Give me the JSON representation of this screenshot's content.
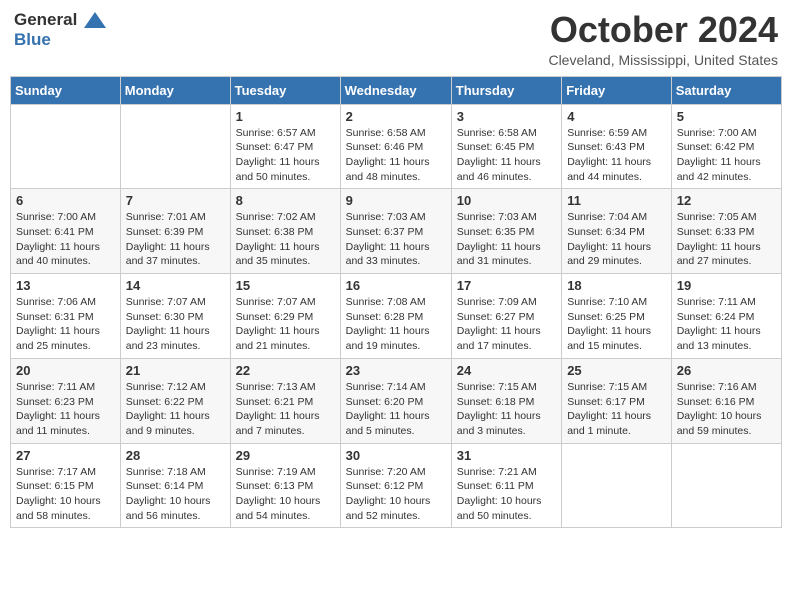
{
  "header": {
    "logo_general": "General",
    "logo_blue": "Blue",
    "month": "October 2024",
    "location": "Cleveland, Mississippi, United States"
  },
  "days_of_week": [
    "Sunday",
    "Monday",
    "Tuesday",
    "Wednesday",
    "Thursday",
    "Friday",
    "Saturday"
  ],
  "weeks": [
    [
      {
        "day": "",
        "info": ""
      },
      {
        "day": "",
        "info": ""
      },
      {
        "day": "1",
        "info": "Sunrise: 6:57 AM\nSunset: 6:47 PM\nDaylight: 11 hours and 50 minutes."
      },
      {
        "day": "2",
        "info": "Sunrise: 6:58 AM\nSunset: 6:46 PM\nDaylight: 11 hours and 48 minutes."
      },
      {
        "day": "3",
        "info": "Sunrise: 6:58 AM\nSunset: 6:45 PM\nDaylight: 11 hours and 46 minutes."
      },
      {
        "day": "4",
        "info": "Sunrise: 6:59 AM\nSunset: 6:43 PM\nDaylight: 11 hours and 44 minutes."
      },
      {
        "day": "5",
        "info": "Sunrise: 7:00 AM\nSunset: 6:42 PM\nDaylight: 11 hours and 42 minutes."
      }
    ],
    [
      {
        "day": "6",
        "info": "Sunrise: 7:00 AM\nSunset: 6:41 PM\nDaylight: 11 hours and 40 minutes."
      },
      {
        "day": "7",
        "info": "Sunrise: 7:01 AM\nSunset: 6:39 PM\nDaylight: 11 hours and 37 minutes."
      },
      {
        "day": "8",
        "info": "Sunrise: 7:02 AM\nSunset: 6:38 PM\nDaylight: 11 hours and 35 minutes."
      },
      {
        "day": "9",
        "info": "Sunrise: 7:03 AM\nSunset: 6:37 PM\nDaylight: 11 hours and 33 minutes."
      },
      {
        "day": "10",
        "info": "Sunrise: 7:03 AM\nSunset: 6:35 PM\nDaylight: 11 hours and 31 minutes."
      },
      {
        "day": "11",
        "info": "Sunrise: 7:04 AM\nSunset: 6:34 PM\nDaylight: 11 hours and 29 minutes."
      },
      {
        "day": "12",
        "info": "Sunrise: 7:05 AM\nSunset: 6:33 PM\nDaylight: 11 hours and 27 minutes."
      }
    ],
    [
      {
        "day": "13",
        "info": "Sunrise: 7:06 AM\nSunset: 6:31 PM\nDaylight: 11 hours and 25 minutes."
      },
      {
        "day": "14",
        "info": "Sunrise: 7:07 AM\nSunset: 6:30 PM\nDaylight: 11 hours and 23 minutes."
      },
      {
        "day": "15",
        "info": "Sunrise: 7:07 AM\nSunset: 6:29 PM\nDaylight: 11 hours and 21 minutes."
      },
      {
        "day": "16",
        "info": "Sunrise: 7:08 AM\nSunset: 6:28 PM\nDaylight: 11 hours and 19 minutes."
      },
      {
        "day": "17",
        "info": "Sunrise: 7:09 AM\nSunset: 6:27 PM\nDaylight: 11 hours and 17 minutes."
      },
      {
        "day": "18",
        "info": "Sunrise: 7:10 AM\nSunset: 6:25 PM\nDaylight: 11 hours and 15 minutes."
      },
      {
        "day": "19",
        "info": "Sunrise: 7:11 AM\nSunset: 6:24 PM\nDaylight: 11 hours and 13 minutes."
      }
    ],
    [
      {
        "day": "20",
        "info": "Sunrise: 7:11 AM\nSunset: 6:23 PM\nDaylight: 11 hours and 11 minutes."
      },
      {
        "day": "21",
        "info": "Sunrise: 7:12 AM\nSunset: 6:22 PM\nDaylight: 11 hours and 9 minutes."
      },
      {
        "day": "22",
        "info": "Sunrise: 7:13 AM\nSunset: 6:21 PM\nDaylight: 11 hours and 7 minutes."
      },
      {
        "day": "23",
        "info": "Sunrise: 7:14 AM\nSunset: 6:20 PM\nDaylight: 11 hours and 5 minutes."
      },
      {
        "day": "24",
        "info": "Sunrise: 7:15 AM\nSunset: 6:18 PM\nDaylight: 11 hours and 3 minutes."
      },
      {
        "day": "25",
        "info": "Sunrise: 7:15 AM\nSunset: 6:17 PM\nDaylight: 11 hours and 1 minute."
      },
      {
        "day": "26",
        "info": "Sunrise: 7:16 AM\nSunset: 6:16 PM\nDaylight: 10 hours and 59 minutes."
      }
    ],
    [
      {
        "day": "27",
        "info": "Sunrise: 7:17 AM\nSunset: 6:15 PM\nDaylight: 10 hours and 58 minutes."
      },
      {
        "day": "28",
        "info": "Sunrise: 7:18 AM\nSunset: 6:14 PM\nDaylight: 10 hours and 56 minutes."
      },
      {
        "day": "29",
        "info": "Sunrise: 7:19 AM\nSunset: 6:13 PM\nDaylight: 10 hours and 54 minutes."
      },
      {
        "day": "30",
        "info": "Sunrise: 7:20 AM\nSunset: 6:12 PM\nDaylight: 10 hours and 52 minutes."
      },
      {
        "day": "31",
        "info": "Sunrise: 7:21 AM\nSunset: 6:11 PM\nDaylight: 10 hours and 50 minutes."
      },
      {
        "day": "",
        "info": ""
      },
      {
        "day": "",
        "info": ""
      }
    ]
  ]
}
